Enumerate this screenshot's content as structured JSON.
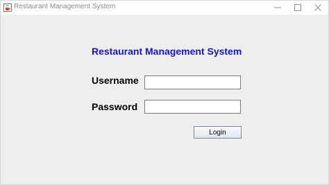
{
  "window": {
    "title": "Restaurant Management System",
    "icon": "java-cup-icon",
    "controls": {
      "minimize": "minimize-icon",
      "maximize": "maximize-icon",
      "close": "close-icon"
    }
  },
  "login_form": {
    "heading": "Restaurant Management System",
    "username_label": "Username",
    "username_value": "",
    "password_label": "Password",
    "password_value": "",
    "login_button": "Login"
  },
  "colors": {
    "heading": "#1515c8",
    "background": "#eeeeee"
  }
}
